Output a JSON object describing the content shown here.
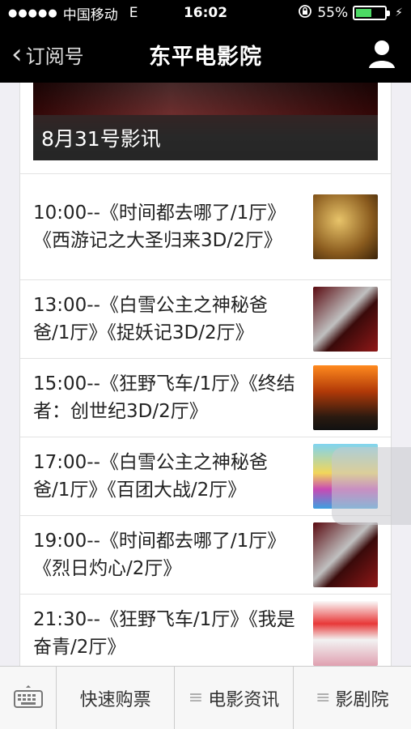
{
  "status_bar": {
    "carrier": "中国移动",
    "network": "E",
    "time": "16:02",
    "battery_percent": "55%",
    "battery_level": 0.55
  },
  "nav": {
    "back_label": "订阅号",
    "title": "东平电影院",
    "user_icon": "user-icon"
  },
  "banner": {
    "caption": "8月31号影讯"
  },
  "schedule": [
    {
      "text": "10:00--《时间都去哪了/1厅》《西游记之大圣归来3D/2厅》"
    },
    {
      "text": "13:00--《白雪公主之神秘爸爸/1厅》《捉妖记3D/2厅》"
    },
    {
      "text": "15:00--《狂野飞车/1厅》《终结者：创世纪3D/2厅》"
    },
    {
      "text": "17:00--《白雪公主之神秘爸爸/1厅》《百团大战/2厅》"
    },
    {
      "text": "19:00--《时间都去哪了/1厅》《烈日灼心/2厅》"
    },
    {
      "text": "21:30--《狂野飞车/1厅》《我是奋青/2厅》"
    }
  ],
  "toolbar": {
    "keyboard_icon": "keyboard-icon",
    "items": [
      "快速购票",
      "电影资讯",
      "影剧院"
    ]
  },
  "colors": {
    "background": "#f0eff4",
    "bar": "#000000",
    "battery": "#4cd964"
  }
}
